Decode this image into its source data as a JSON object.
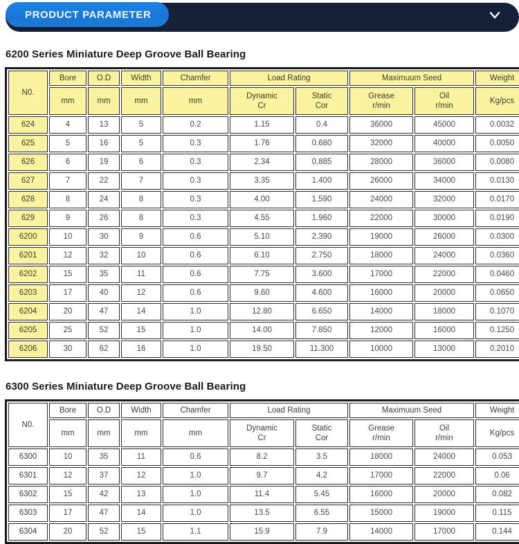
{
  "banner": {
    "pill_label": "PRODUCT PARAMETER",
    "chevron_icon": "chevron-down-icon",
    "bar_color": "#141f38",
    "pill_color": "#1878d8"
  },
  "theme": {
    "header_fill": "#faf4a0",
    "border_color": "#1a1a1a",
    "text_color": "#4a4a4a"
  },
  "tables": [
    {
      "title": "6200 Series Miniature Deep Groove Ball Bearing",
      "style": "amber",
      "header": {
        "no": "N0.",
        "groups": [
          {
            "label": "Bore",
            "unit": "mm"
          },
          {
            "label": "O.D",
            "unit": "mm"
          },
          {
            "label": "Width",
            "unit": "mm"
          },
          {
            "label": "Chamfer",
            "unit": "mm"
          }
        ],
        "load_rating": {
          "label": "Load Rating",
          "dynamic_l1": "Dynamic",
          "dynamic_l2": "Cr",
          "static_l1": "Static",
          "static_l2": "Cor"
        },
        "max_speed": {
          "label": "Maximuum Seed",
          "grease_l1": "Grease",
          "grease_l2": "r/min",
          "oil_l1": "Oil",
          "oil_l2": "r/min"
        },
        "weight": {
          "label": "Weight",
          "unit": "Kg/pcs"
        }
      },
      "columns": [
        "N0.",
        "Bore mm",
        "O.D mm",
        "Width mm",
        "Chamfer mm",
        "Dynamic Cr",
        "Static Cor",
        "Grease r/min",
        "Oil r/min",
        "Kg/pcs"
      ],
      "rows": [
        [
          "624",
          "4",
          "13",
          "5",
          "0.2",
          "1.15",
          "0.4",
          "36000",
          "45000",
          "0.0032"
        ],
        [
          "625",
          "5",
          "16",
          "5",
          "0.3",
          "1.76",
          "0.680",
          "32000",
          "40000",
          "0.0050"
        ],
        [
          "626",
          "6",
          "19",
          "6",
          "0.3",
          "2.34",
          "0.885",
          "28000",
          "36000",
          "0.0080"
        ],
        [
          "627",
          "7",
          "22",
          "7",
          "0.3",
          "3.35",
          "1.400",
          "26000",
          "34000",
          "0.0130"
        ],
        [
          "628",
          "8",
          "24",
          "8",
          "0.3",
          "4.00",
          "1.590",
          "24000",
          "32000",
          "0.0170"
        ],
        [
          "629",
          "9",
          "26",
          "8",
          "0.3",
          "4.55",
          "1.960",
          "22000",
          "30000",
          "0.0190"
        ],
        [
          "6200",
          "10",
          "30",
          "9",
          "0.6",
          "5.10",
          "2.390",
          "19000",
          "26000",
          "0.0300"
        ],
        [
          "6201",
          "12",
          "32",
          "10",
          "0.6",
          "6.10",
          "2.750",
          "18000",
          "24000",
          "0.0360"
        ],
        [
          "6202",
          "15",
          "35",
          "11",
          "0.6",
          "7.75",
          "3.600",
          "17000",
          "22000",
          "0.0460"
        ],
        [
          "6203",
          "17",
          "40",
          "12",
          "0.6",
          "9.60",
          "4.600",
          "16000",
          "20000",
          "0.0650"
        ],
        [
          "6204",
          "20",
          "47",
          "14",
          "1.0",
          "12.80",
          "6.650",
          "14000",
          "18000",
          "0.1070"
        ],
        [
          "6205",
          "25",
          "52",
          "15",
          "1.0",
          "14.00",
          "7.850",
          "12000",
          "16000",
          "0.1250"
        ],
        [
          "6206",
          "30",
          "62",
          "16",
          "1.0",
          "19.50",
          "11.300",
          "10000",
          "13000",
          "0.2010"
        ]
      ]
    },
    {
      "title": "6300 Series Miniature Deep Groove Ball Bearing",
      "style": "plain",
      "header": {
        "no": "N0.",
        "groups": [
          {
            "label": "Bore",
            "unit": "mm"
          },
          {
            "label": "O.D",
            "unit": "mm"
          },
          {
            "label": "Width",
            "unit": "mm"
          },
          {
            "label": "Chamfer",
            "unit": "mm"
          }
        ],
        "load_rating": {
          "label": "Load Rating",
          "dynamic_l1": "Dynamic",
          "dynamic_l2": "Cr",
          "static_l1": "Static",
          "static_l2": "Cor"
        },
        "max_speed": {
          "label": "Maximuum Seed",
          "grease_l1": "Grease",
          "grease_l2": "r/min",
          "oil_l1": "Oil",
          "oil_l2": "r/min"
        },
        "weight": {
          "label": "Weight",
          "unit": "Kg/pcs"
        }
      },
      "columns": [
        "N0.",
        "Bore mm",
        "O.D mm",
        "Width mm",
        "Chamfer mm",
        "Dynamic Cr",
        "Static Cor",
        "Grease r/min",
        "Oil r/min",
        "Kg/pcs"
      ],
      "rows": [
        [
          "6300",
          "10",
          "35",
          "11",
          "0.6",
          "8.2",
          "3.5",
          "18000",
          "24000",
          "0.053"
        ],
        [
          "6301",
          "12",
          "37",
          "12",
          "1.0",
          "9.7",
          "4.2",
          "17000",
          "22000",
          "0.06"
        ],
        [
          "6302",
          "15",
          "42",
          "13",
          "1.0",
          "11.4",
          "5.45",
          "16000",
          "20000",
          "0.082"
        ],
        [
          "6303",
          "17",
          "47",
          "14",
          "1.0",
          "13.5",
          "6.55",
          "15000",
          "19000",
          "0.115"
        ],
        [
          "6304",
          "20",
          "52",
          "15",
          "1.1",
          "15.9",
          "7.9",
          "14000",
          "17000",
          "0.144"
        ]
      ]
    }
  ]
}
